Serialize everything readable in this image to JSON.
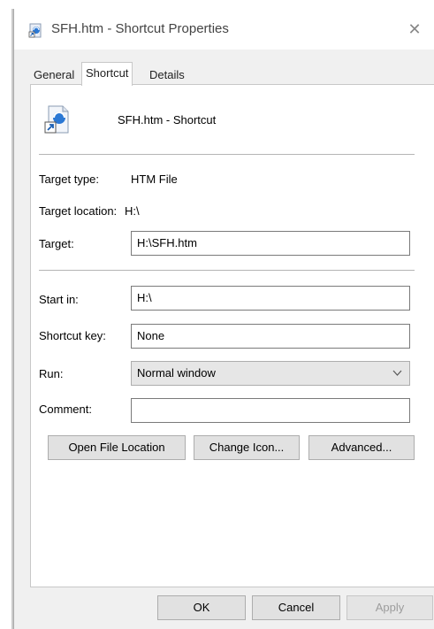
{
  "window": {
    "title": "SFH.htm - Shortcut Properties",
    "close_glyph": "✕"
  },
  "tabs": [
    {
      "label": "General",
      "selected": false
    },
    {
      "label": "Shortcut",
      "selected": true
    },
    {
      "label": "Details",
      "selected": false
    }
  ],
  "shortcut": {
    "name": "SFH.htm - Shortcut",
    "icon": "htm-shortcut-icon"
  },
  "fields": {
    "target_type_label": "Target type:",
    "target_type_value": "HTM File",
    "target_location_label": "Target location:",
    "target_location_value": "H:\\",
    "target_label": "Target:",
    "target_value": "H:\\SFH.htm",
    "start_in_label": "Start in:",
    "start_in_value": "H:\\",
    "shortcut_key_label": "Shortcut key:",
    "shortcut_key_value": "None",
    "run_label": "Run:",
    "run_value": "Normal window",
    "comment_label": "Comment:",
    "comment_value": ""
  },
  "actions": {
    "open_file_location": "Open File Location",
    "change_icon": "Change Icon...",
    "advanced": "Advanced..."
  },
  "footer": {
    "ok": "OK",
    "cancel": "Cancel",
    "apply": "Apply",
    "apply_enabled": false
  }
}
